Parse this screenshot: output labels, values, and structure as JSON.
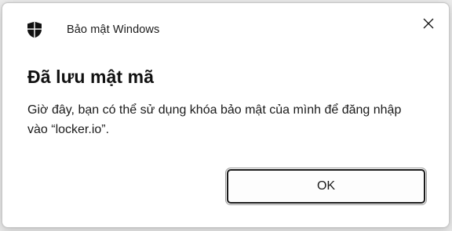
{
  "dialog": {
    "app_title": "Bảo mật Windows",
    "heading": "Đã lưu mật mã",
    "message": "Giờ đây, bạn có thể sử dụng khóa bảo mật của mình để đăng nhập vào “locker.io”.",
    "ok_label": "OK",
    "icons": {
      "app": "shield-icon",
      "close": "close-icon"
    }
  },
  "colors": {
    "dialog_bg": "#ffffff",
    "page_bg": "#ececec",
    "text": "#1a1a1a",
    "button_border": "#1a1a1a"
  }
}
